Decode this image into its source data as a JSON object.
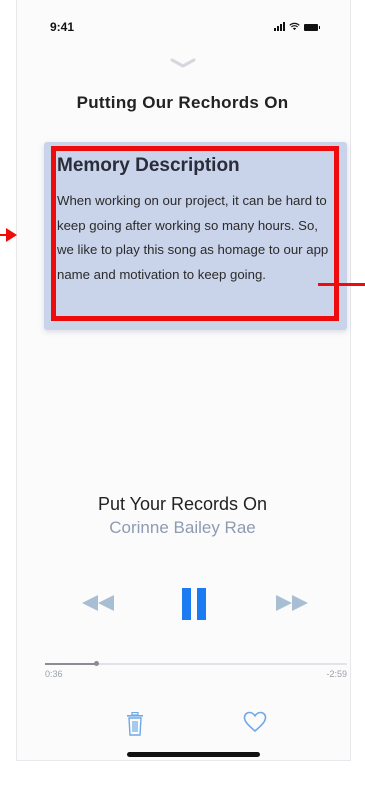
{
  "status_bar": {
    "time": "9:41"
  },
  "header": {
    "title": "Putting Our Rechords On"
  },
  "memory": {
    "heading": "Memory Description",
    "body": "When working on our project, it can be hard to keep going after working so many hours. So, we like to play this song as homage to our app name and motivation to keep going."
  },
  "track": {
    "title": "Put Your Records On",
    "artist": "Corinne Bailey Rae"
  },
  "player": {
    "elapsed": "0:36",
    "remaining": "-2:59",
    "progress": 0.17,
    "state": "playing"
  },
  "icons": {
    "collapse": "chevron-down-icon",
    "rewind": "rewind-icon",
    "pause": "pause-icon",
    "forward": "fast-forward-icon",
    "delete": "trash-icon",
    "favorite": "heart-icon"
  },
  "colors": {
    "accent": "#1a7cf0",
    "controls_inactive": "#a8bed3",
    "card_background": "#c9d3ea",
    "annotation_red": "#ee0b0b"
  }
}
